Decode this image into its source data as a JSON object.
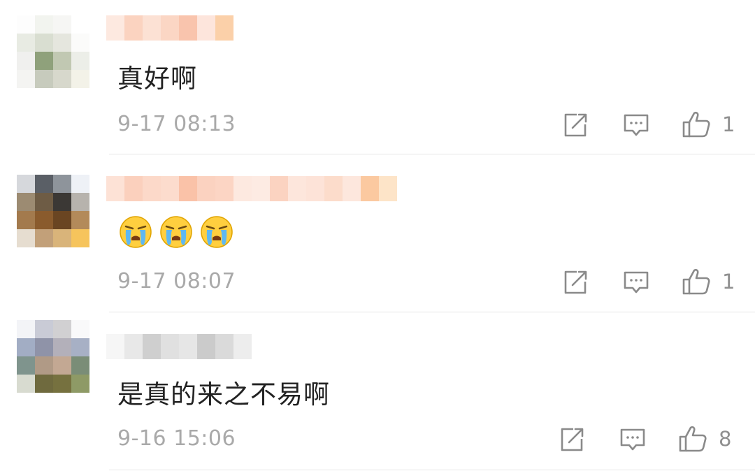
{
  "comments": [
    {
      "content": "真好啊",
      "time": "9-17 08:13",
      "likes": "1"
    },
    {
      "content": "",
      "emojis": [
        "crying-face",
        "crying-face",
        "crying-face"
      ],
      "time": "9-17 08:07",
      "likes": "1"
    },
    {
      "content": "是真的来之不易啊",
      "time": "9-16 15:06",
      "likes": "8"
    }
  ],
  "colors": {
    "time_text": "#a9a9a9",
    "icon_stroke": "#8a8a8a",
    "divider": "#e6e6e6"
  },
  "icons": [
    "share-icon",
    "comment-icon",
    "like-icon"
  ]
}
